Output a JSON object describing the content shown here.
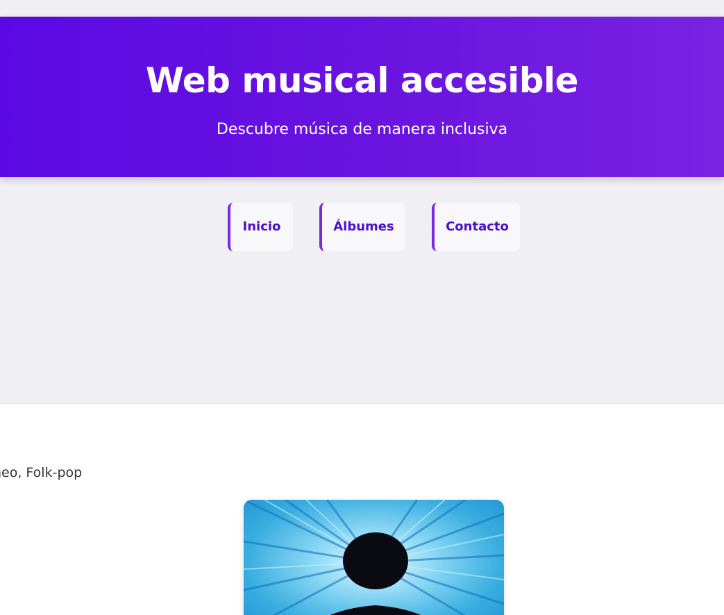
{
  "header": {
    "title": "Web musical accesible",
    "subtitle": "Descubre música de manera inclusiva"
  },
  "nav": {
    "items": [
      {
        "label": "Inicio"
      },
      {
        "label": "Álbumes"
      },
      {
        "label": "Contacto"
      }
    ]
  },
  "main": {
    "genre_text": "neo, Folk-pop"
  },
  "colors": {
    "header_gradient_start": "#5b09e2",
    "header_gradient_end": "#7a22e2",
    "nav_text": "#4c0fcf",
    "nav_accent": "#7a2be0",
    "page_background": "#f0f0f4"
  }
}
